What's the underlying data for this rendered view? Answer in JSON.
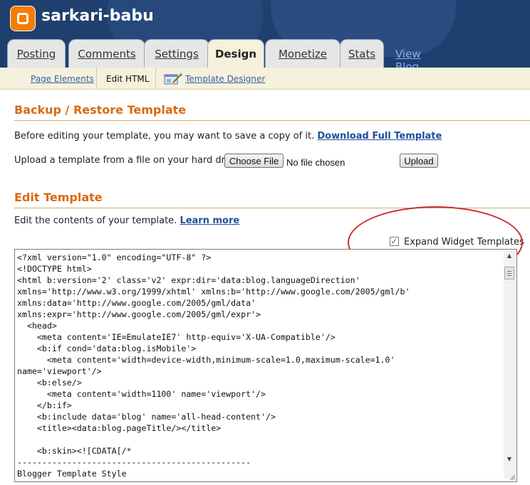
{
  "header": {
    "blog_title": "sarkari-babu",
    "tabs": [
      {
        "label": "Posting",
        "active": false
      },
      {
        "label": "Comments",
        "active": false
      },
      {
        "label": "Settings",
        "active": false
      },
      {
        "label": "Design",
        "active": true
      },
      {
        "label": "Monetize",
        "active": false
      },
      {
        "label": "Stats",
        "active": false
      }
    ],
    "view_blog": "View Blog",
    "colors": {
      "header_bg": "#1f3f6f",
      "logo": "#f57d00",
      "accent": "#d86a10"
    }
  },
  "subnav": {
    "page_elements": "Page Elements",
    "edit_html": "Edit HTML",
    "template_designer": "Template Designer"
  },
  "backup": {
    "title": "Backup / Restore Template",
    "before_text": "Before editing your template, you may want to save a copy of it.",
    "download_link": "Download Full Template",
    "upload_text": "Upload a template from a file on your hard drive:",
    "choose_file": "Choose File",
    "no_file": "No file chosen",
    "upload_button": "Upload"
  },
  "edit": {
    "title": "Edit Template",
    "intro_text": "Edit the contents of your template.",
    "learn_more": "Learn more",
    "expand_label": "Expand Widget Templates",
    "expand_checked": true,
    "code": "<?xml version=\"1.0\" encoding=\"UTF-8\" ?>\n<!DOCTYPE html>\n<html b:version='2' class='v2' expr:dir='data:blog.languageDirection'\nxmlns='http://www.w3.org/1999/xhtml' xmlns:b='http://www.google.com/2005/gml/b'\nxmlns:data='http://www.google.com/2005/gml/data'\nxmlns:expr='http://www.google.com/2005/gml/expr'>\n  <head>\n    <meta content='IE=EmulateIE7' http-equiv='X-UA-Compatible'/>\n    <b:if cond='data:blog.isMobile'>\n      <meta content='width=device-width,minimum-scale=1.0,maximum-scale=1.0'\nname='viewport'/>\n    <b:else/>\n      <meta content='width=1100' name='viewport'/>\n    </b:if>\n    <b:include data='blog' name='all-head-content'/>\n    <title><data:blog.pageTitle/></title>\n\n    <b:skin><![CDATA[/*\n-----------------------------------------------\nBlogger Template Style\nName:      Simple"
  }
}
